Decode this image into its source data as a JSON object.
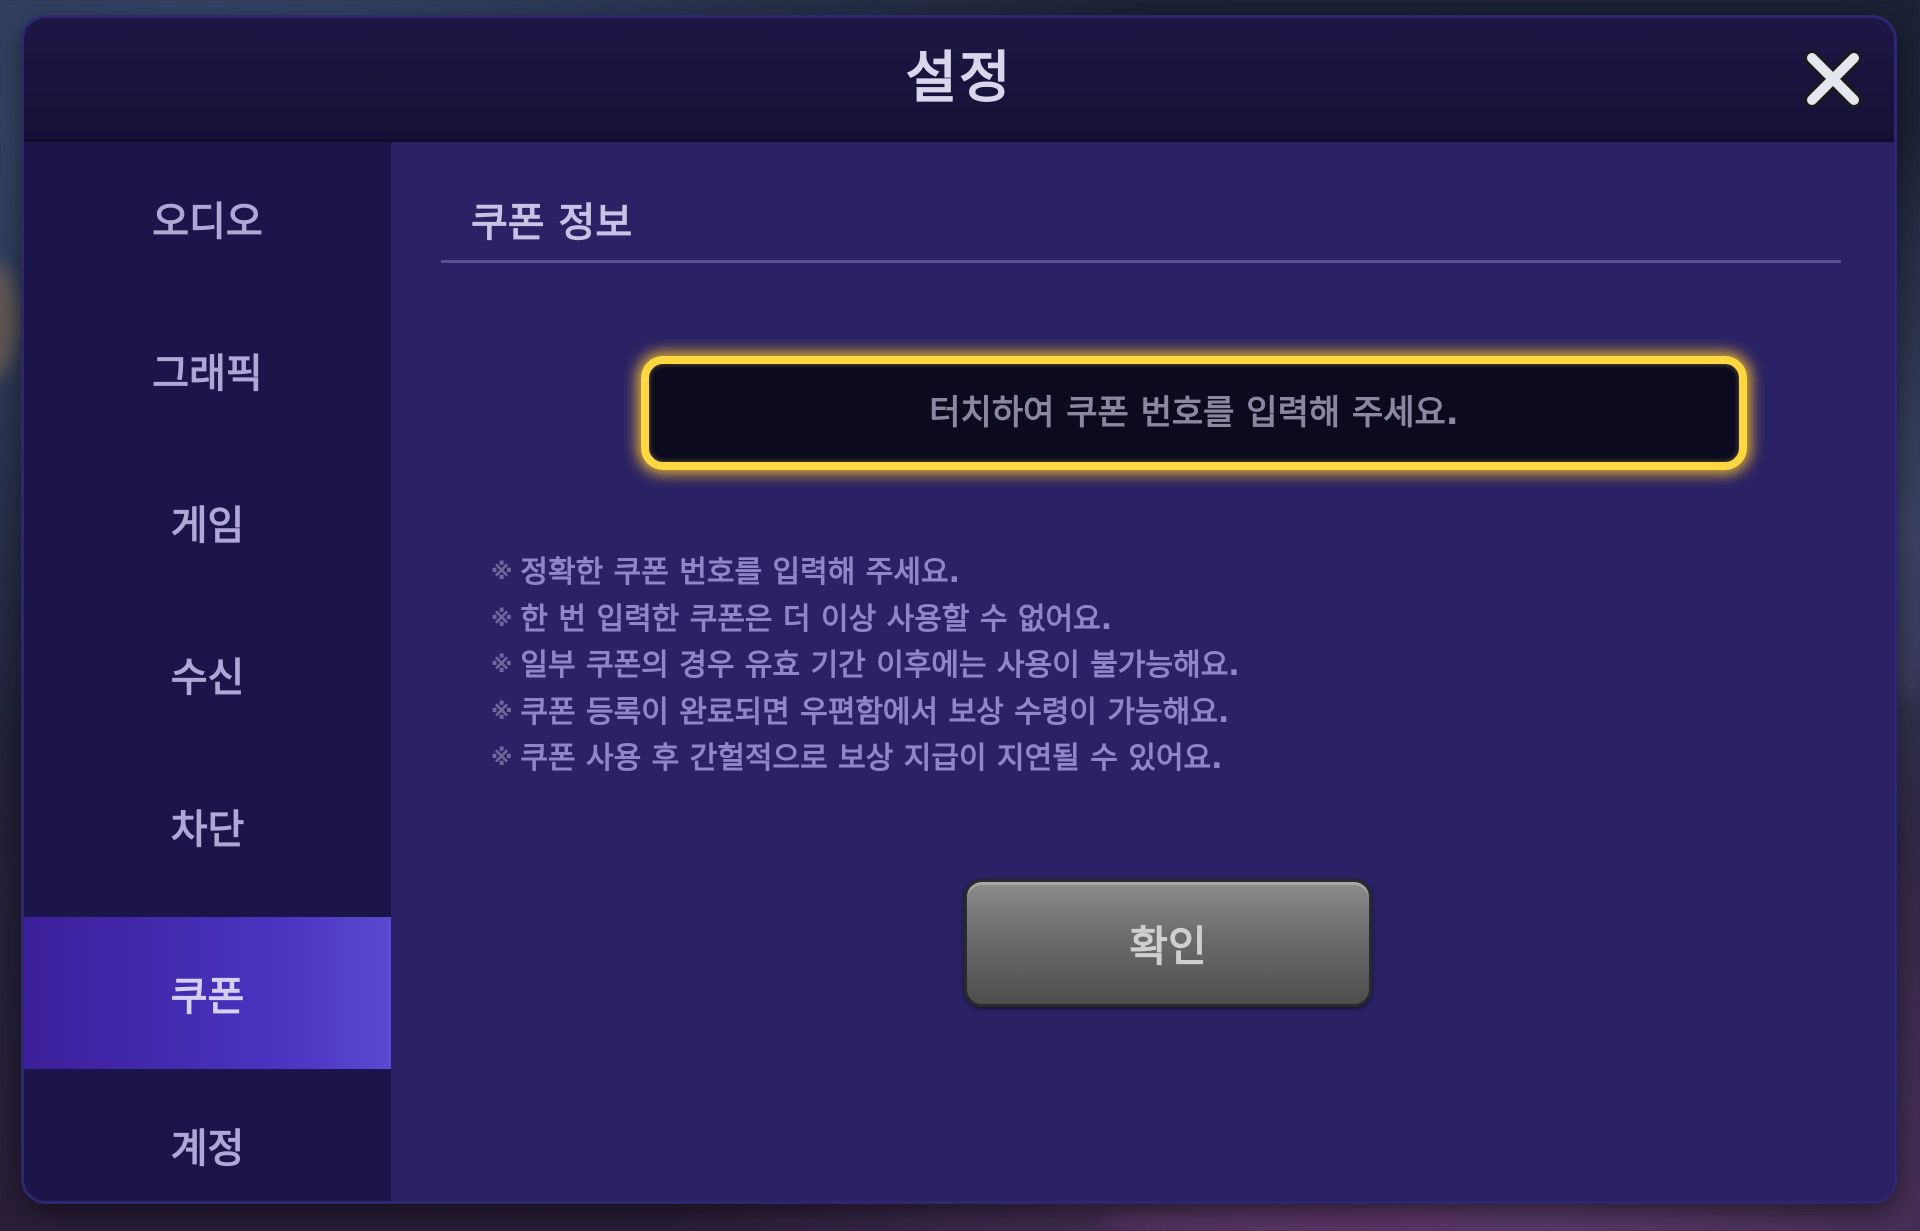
{
  "dialog": {
    "title": "설정",
    "close_icon": "close-icon"
  },
  "sidebar": {
    "items": [
      {
        "label": "오디오",
        "active": false
      },
      {
        "label": "그래픽",
        "active": false
      },
      {
        "label": "게임",
        "active": false
      },
      {
        "label": "수신",
        "active": false
      },
      {
        "label": "차단",
        "active": false
      },
      {
        "label": "쿠폰",
        "active": true
      },
      {
        "label": "계정",
        "active": false
      }
    ]
  },
  "coupon": {
    "section_title": "쿠폰 정보",
    "input_placeholder": "터치하여 쿠폰 번호를 입력해 주세요.",
    "input_value": "",
    "note_mark": "※",
    "notes": [
      "정확한 쿠폰 번호를 입력해 주세요.",
      "한 번 입력한 쿠폰은 더 이상 사용할 수 없어요.",
      "일부 쿠폰의 경우 유효 기간 이후에는 사용이 불가능해요.",
      "쿠폰 등록이 완료되면 우편함에서 보상 수령이 가능해요.",
      "쿠폰 사용 후 간헐적으로 보상 지급이 지연될 수 있어요."
    ],
    "confirm_label": "확인"
  },
  "colors": {
    "accent_highlight": "#ffd740",
    "active_tab": "#4a34c0",
    "panel_bg": "#2a2264"
  }
}
